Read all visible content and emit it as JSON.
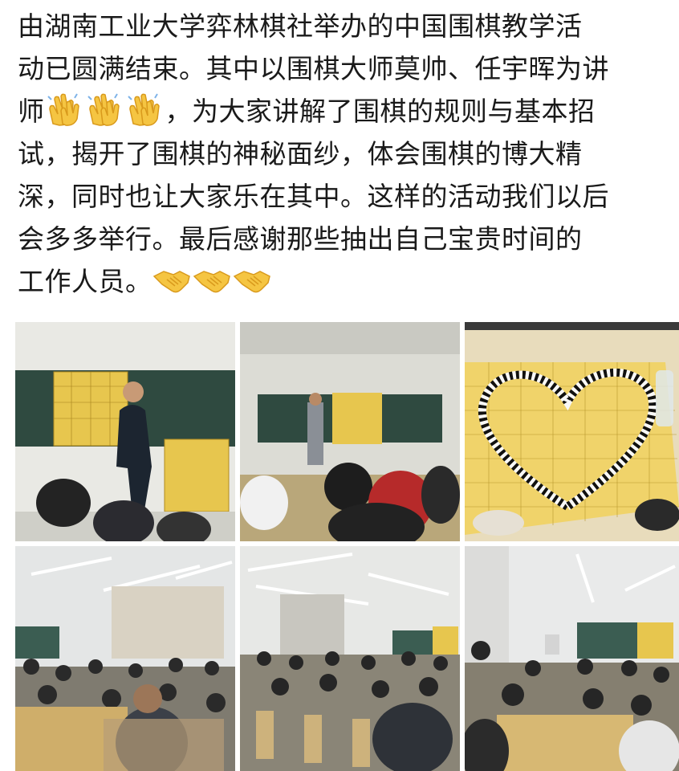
{
  "post": {
    "lines": [
      "由湖南工业大学弈林棋社举办的中国围棋教学活",
      "动已圆满结束。其中以围棋大师莫帅、任宇晖为讲",
      "师",
      "，为大家讲解了围棋的规则与基本招",
      "试，揭开了围棋的神秘面纱，体会围棋的博大精",
      "深，同时也让大家乐在其中。这样的活动我们以后",
      "会多多举行。最后感谢那些抽出自己宝贵时间的",
      "工作人员。"
    ],
    "emojis": [
      "clapping-hands",
      "clapping-hands",
      "clapping-hands",
      "handshake",
      "handshake",
      "handshake"
    ]
  },
  "photos": [
    {
      "name": "instructor-at-board"
    },
    {
      "name": "class-seated-at-boards"
    },
    {
      "name": "heart-of-stones"
    },
    {
      "name": "classroom-wide-left"
    },
    {
      "name": "classroom-wide-center"
    },
    {
      "name": "classroom-wide-right"
    }
  ],
  "colors": {
    "text": "#1a1a1a",
    "board": "#e7c64e",
    "chalkboard": "#2f4a40",
    "wall": "#e9e9e4"
  }
}
